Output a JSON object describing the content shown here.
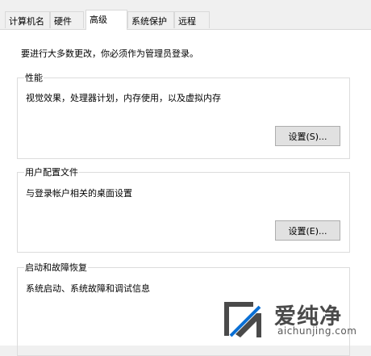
{
  "tabs": [
    {
      "label": "计算机名"
    },
    {
      "label": "硬件"
    },
    {
      "label": "高级"
    },
    {
      "label": "系统保护"
    },
    {
      "label": "远程"
    }
  ],
  "active_tab": "高级",
  "intro": "要进行大多数更改，你必须作为管理员登录。",
  "groups": {
    "performance": {
      "title": "性能",
      "desc": "视觉效果，处理器计划，内存使用，以及虚拟内存",
      "button": "设置(S)..."
    },
    "user_profiles": {
      "title": "用户配置文件",
      "desc": "与登录帐户相关的桌面设置",
      "button": "设置(E)..."
    },
    "startup": {
      "title": "启动和故障恢复",
      "desc": "系统启动、系统故障和调试信息"
    }
  },
  "watermark": {
    "name": "爱纯净",
    "url": "aichunjing.com"
  },
  "colors": {
    "accent": "#0a6fd4"
  }
}
